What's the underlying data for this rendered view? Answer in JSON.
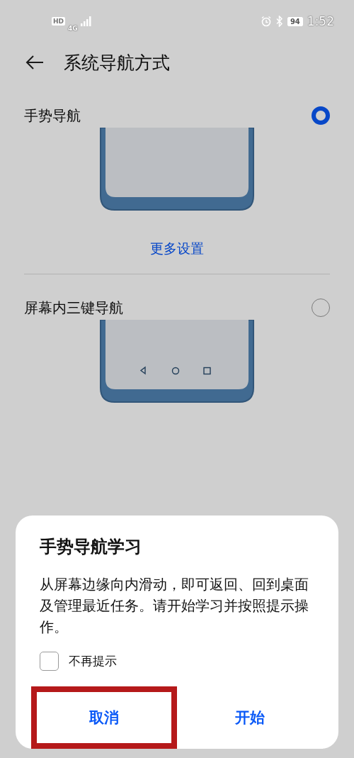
{
  "status_bar": {
    "hd": "HD",
    "network": "4G",
    "battery": "94",
    "time": "1:52"
  },
  "header": {
    "title": "系统导航方式"
  },
  "options": [
    {
      "label": "手势导航",
      "kind": "gesture",
      "selected": true,
      "link": "更多设置"
    },
    {
      "label": "屏幕内三键导航",
      "kind": "three-key",
      "selected": false
    }
  ],
  "dialog": {
    "title": "手势导航学习",
    "message": "从屏幕边缘向内滑动，即可返回、回到桌面及管理最近任务。请开始学习并按照提示操作。",
    "checkbox": {
      "label": "不再提示",
      "checked": false
    },
    "buttons": [
      {
        "label": "取消",
        "highlighted": true
      },
      {
        "label": "开始",
        "highlighted": false
      }
    ]
  }
}
